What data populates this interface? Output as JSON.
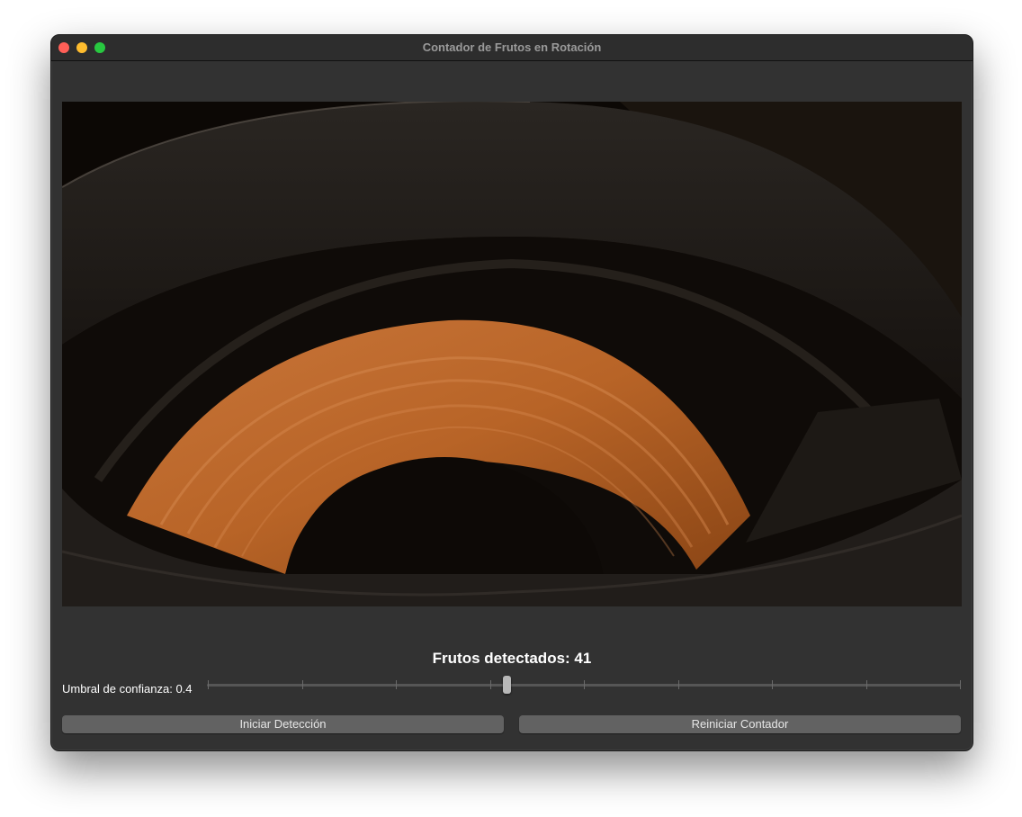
{
  "window": {
    "title": "Contador de Frutos en Rotación"
  },
  "counter": {
    "text": "Frutos detectados: 41"
  },
  "threshold": {
    "label": "Umbral de confianza: 0.4",
    "value": 0.4,
    "min": 0,
    "max": 1,
    "tick_count": 9
  },
  "buttons": {
    "start_label": "Iniciar Detección",
    "reset_label": "Reiniciar Contador"
  },
  "colors": {
    "window_bg": "#323232",
    "close": "#ff5f57",
    "minimize": "#febc2e",
    "maximize": "#28c840",
    "button_bg": "#626262",
    "fruit_orange": "#c26a2a"
  }
}
